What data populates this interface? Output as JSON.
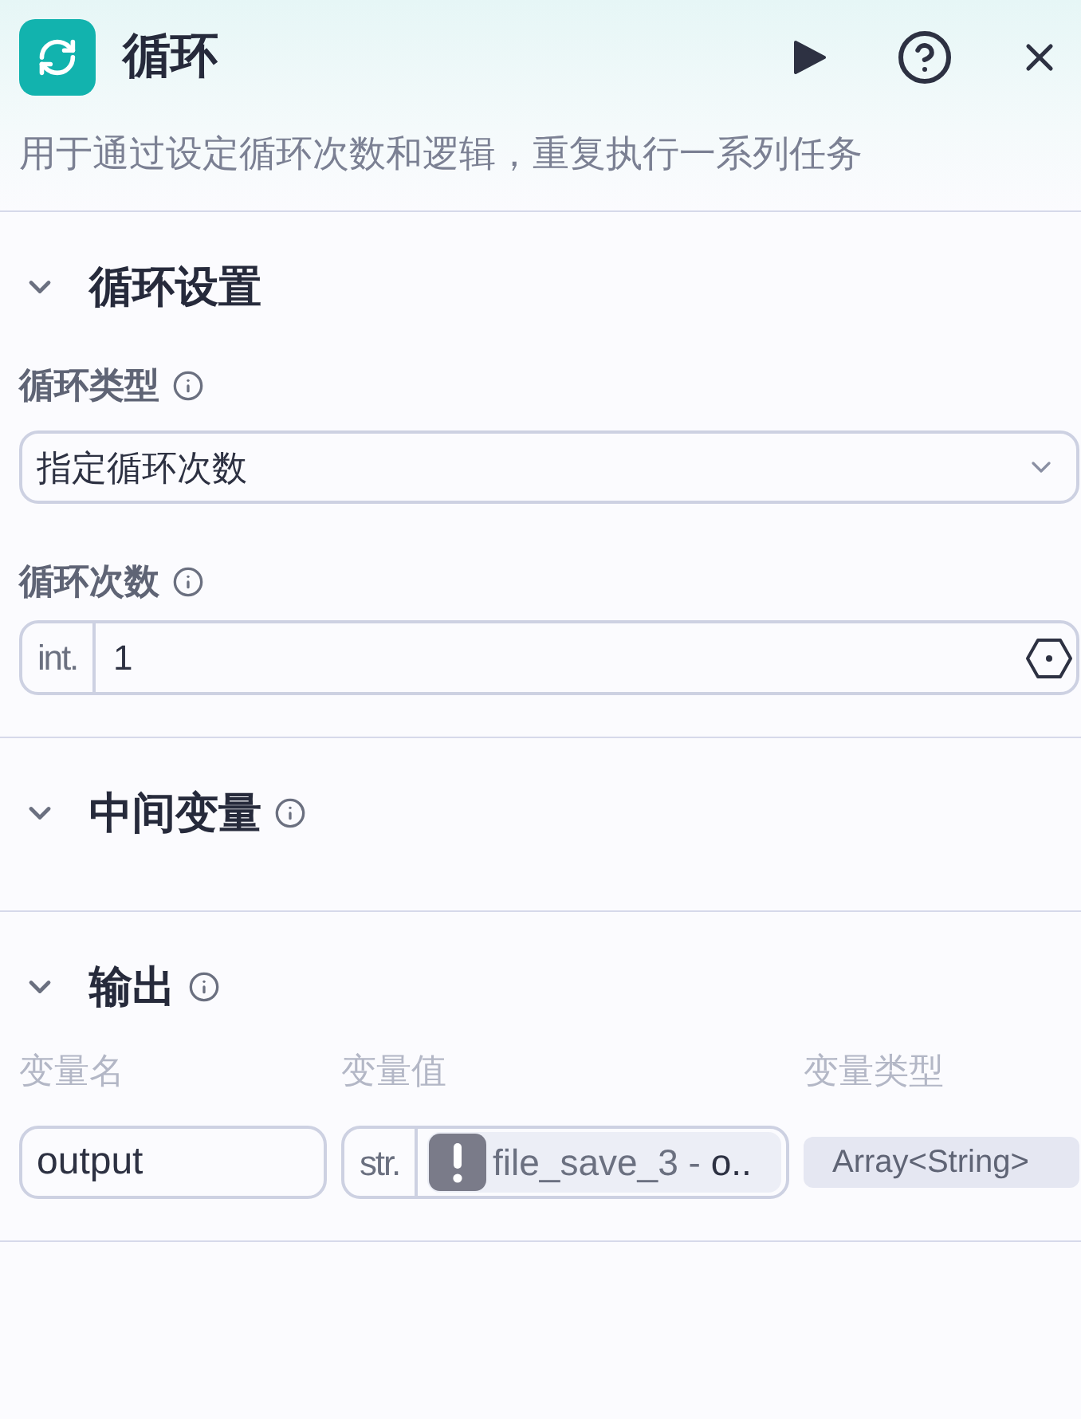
{
  "header": {
    "title": "循环",
    "description": "用于通过设定循环次数和逻辑，重复执行一系列任务"
  },
  "sections": [
    {
      "title": "循环设置",
      "expanded": true,
      "info": false,
      "fields": [
        {
          "kind": "select",
          "label": "循环类型",
          "info": true,
          "value": "指定循环次数"
        },
        {
          "kind": "typed_input",
          "label": "循环次数",
          "info": true,
          "type_prefix": "int.",
          "value": "1"
        }
      ]
    },
    {
      "title": "中间变量",
      "expanded": true,
      "info": true
    },
    {
      "title": "输出",
      "expanded": true,
      "info": true,
      "columns": [
        "变量名",
        "变量值",
        "变量类型"
      ],
      "rows": [
        {
          "name": "output",
          "value_prefix": "str.",
          "warning": true,
          "source_node": "file_save_3 -",
          "variable": "o..",
          "type": "Array<String>"
        }
      ]
    }
  ]
}
